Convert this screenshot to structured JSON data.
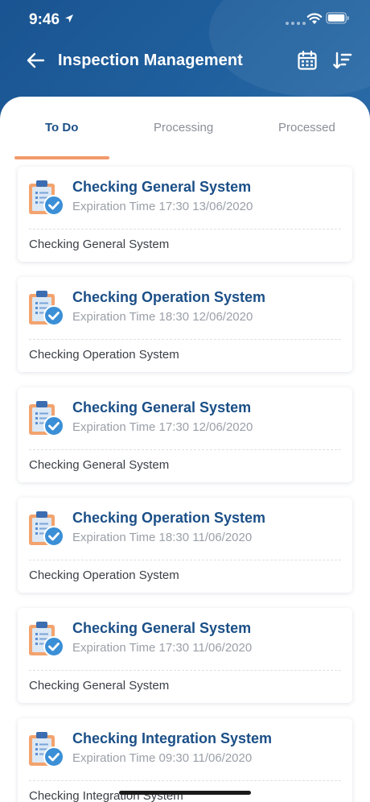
{
  "status_bar": {
    "time": "9:46"
  },
  "nav": {
    "title": "Inspection Management"
  },
  "tabs": [
    {
      "label": "To Do",
      "active": true
    },
    {
      "label": "Processing",
      "active": false
    },
    {
      "label": "Processed",
      "active": false
    }
  ],
  "colors": {
    "header": "#1c5a96",
    "title": "#1b4f87",
    "tab_indicator": "#f29a6a",
    "icon_clipboard": "#f3a36e",
    "icon_check": "#3b8fd6"
  },
  "tasks": [
    {
      "title": "Checking General System",
      "expiration": "Expiration Time 17:30 13/06/2020",
      "description": "Checking General System",
      "icon": "clipboard-check-icon"
    },
    {
      "title": "Checking Operation System",
      "expiration": "Expiration Time 18:30 12/06/2020",
      "description": "Checking Operation System",
      "icon": "clipboard-check-icon"
    },
    {
      "title": "Checking General System",
      "expiration": "Expiration Time 17:30 12/06/2020",
      "description": "Checking General System",
      "icon": "clipboard-check-icon"
    },
    {
      "title": "Checking Operation System",
      "expiration": "Expiration Time 18:30 11/06/2020",
      "description": "Checking Operation System",
      "icon": "clipboard-check-icon"
    },
    {
      "title": "Checking General System",
      "expiration": "Expiration Time 17:30 11/06/2020",
      "description": "Checking General System",
      "icon": "clipboard-check-icon"
    },
    {
      "title": "Checking Integration System",
      "expiration": "Expiration Time 09:30 11/06/2020",
      "description": "Checking Integration System",
      "icon": "clipboard-check-icon"
    }
  ]
}
